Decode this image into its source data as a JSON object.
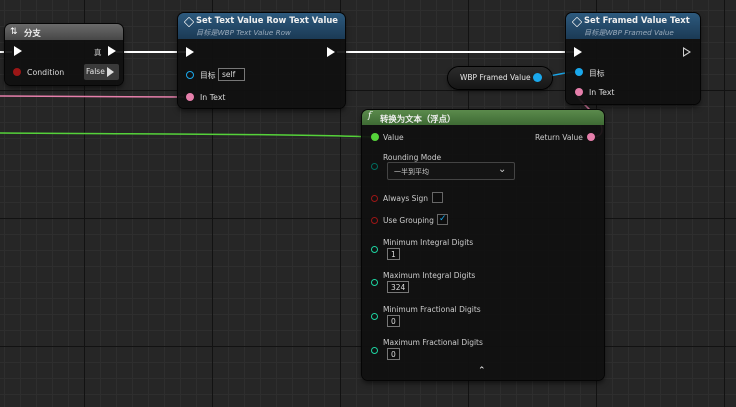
{
  "branch_node": {
    "title": "分支",
    "true_label": "真",
    "condition_label": "Condition",
    "false_label": "False"
  },
  "set_text_node": {
    "title": "Set Text Value Row Text Value",
    "subtitle": "目标是WBP Text Value Row",
    "target_label": "目标",
    "target_value": "self",
    "in_text_label": "In Text"
  },
  "set_framed_node": {
    "title": "Set Framed Value Text",
    "subtitle": "目标是WBP Framed Value",
    "target_label": "目标",
    "in_text_label": "In Text"
  },
  "variable_node": {
    "label": "WBP Framed Value"
  },
  "convert_node": {
    "title": "转换为文本（浮点）",
    "value_label": "Value",
    "return_label": "Return Value",
    "rounding_mode_label": "Rounding Mode",
    "rounding_mode_value": "一半到平均",
    "always_sign_label": "Always Sign",
    "always_sign_checked": false,
    "use_grouping_label": "Use Grouping",
    "use_grouping_checked": true,
    "min_integral_label": "Minimum Integral Digits",
    "min_integral_value": "1",
    "max_integral_label": "Maximum Integral Digits",
    "max_integral_value": "324",
    "min_fractional_label": "Minimum Fractional Digits",
    "min_fractional_value": "0",
    "max_fractional_label": "Maximum Fractional Digits",
    "max_fractional_value": "0"
  },
  "colors": {
    "exec_wire": "#ffffff",
    "text_wire": "#e67fab",
    "float_wire": "#55d23a",
    "object_pin": "#1aa8ec",
    "bool_pin": "#9b1616",
    "byte_pin": "#006c5f",
    "func_header": "#1b3a55",
    "pure_header": "#3e6b34"
  }
}
